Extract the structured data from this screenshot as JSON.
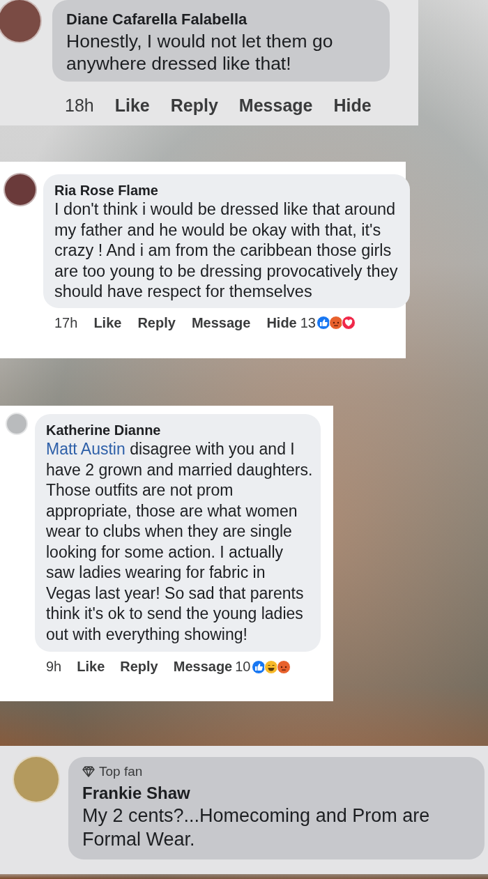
{
  "comments": [
    {
      "author": "Diane Cafarella Falabella",
      "body": [
        {
          "kind": "text",
          "text": "Honestly, I would not let them go anywhere dressed like that!"
        }
      ],
      "time": "18h",
      "actions": [
        "Like",
        "Reply",
        "Message",
        "Hide"
      ]
    },
    {
      "author": "Ria Rose Flame",
      "body": [
        {
          "kind": "text",
          "text": "I don't think i would be dressed like that around my father and he would be okay with that, it's crazy ! And i am from the caribbean those girls are too young to be dressing provocatively they should have respect for themselves"
        }
      ],
      "time": "17h",
      "actions": [
        "Like",
        "Reply",
        "Message",
        "Hide"
      ],
      "reaction_count": "13",
      "reactions": [
        {
          "kind": "like"
        },
        {
          "kind": "angry"
        },
        {
          "kind": "love"
        }
      ]
    },
    {
      "author": "Katherine Dianne",
      "body": [
        {
          "kind": "mention",
          "text": "Matt Austin"
        },
        {
          "kind": "text",
          "text": " disagree with you and I have 2 grown and married daughters. Those outfits are not prom appropriate, those are what women wear to clubs when they are single looking for some action. I actually saw ladies wearing for fabric in Vegas last year! So sad that parents think it's ok to send the young ladies out with everything showing!"
        }
      ],
      "time": "9h",
      "actions": [
        "Like",
        "Reply",
        "Message"
      ],
      "reaction_count": "10",
      "reactions": [
        {
          "kind": "like"
        },
        {
          "kind": "haha"
        },
        {
          "kind": "angry"
        }
      ]
    },
    {
      "badge": "Top fan",
      "author": "Frankie Shaw",
      "body": [
        {
          "kind": "text",
          "text": "My 2 cents?...Homecoming and Prom are Formal Wear."
        }
      ]
    }
  ]
}
